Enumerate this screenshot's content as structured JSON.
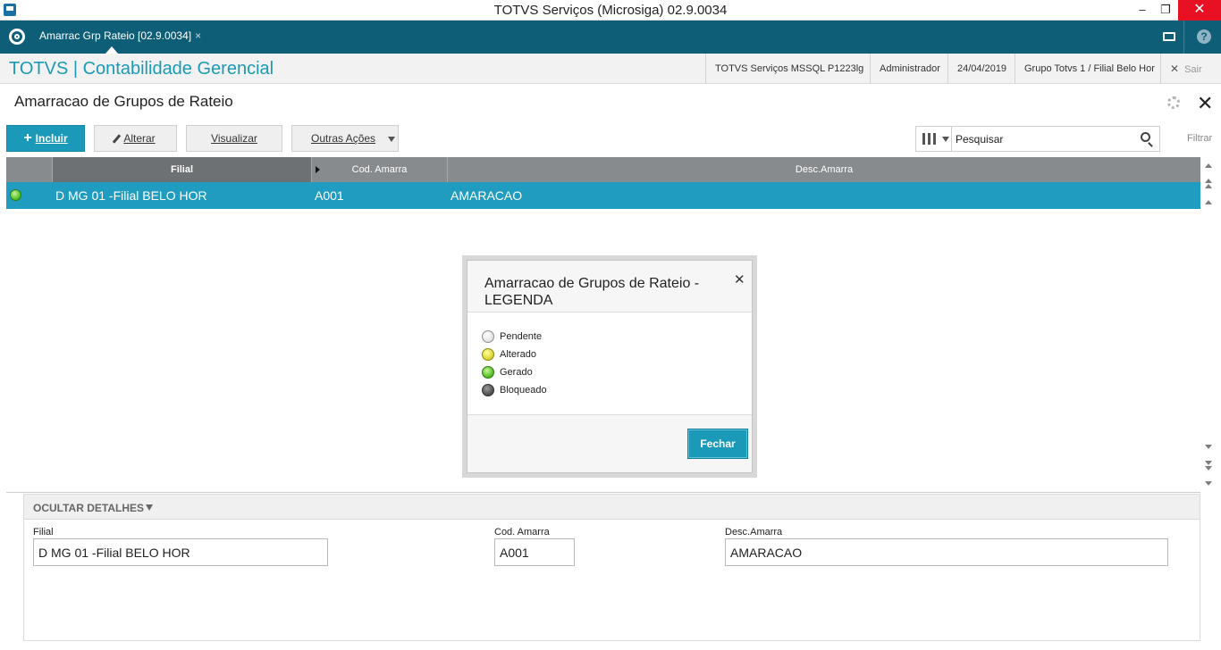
{
  "window": {
    "title": "TOTVS Serviços (Microsiga) 02.9.0034",
    "minimize": "–",
    "restore": "❐",
    "close": "✕"
  },
  "tabbar": {
    "tab_label": "Amarrac Grp Rateio [02.9.0034]",
    "tab_close": "×",
    "help": "?"
  },
  "module": {
    "title": "TOTVS | Contabilidade Gerencial",
    "server": "TOTVS Serviços MSSQL P1223lg",
    "user": "Administrador",
    "date": "24/04/2019",
    "branch": "Grupo Totvs 1 / Filial Belo Hor",
    "exit_icon": "✕",
    "exit_label": "Sair"
  },
  "page": {
    "title": "Amarracao de Grupos de Rateio",
    "close_icon": "✕"
  },
  "toolbar": {
    "incluir": "Incluir",
    "incluir_icon": "+",
    "alterar": "Alterar",
    "visualizar": "Visualizar",
    "outras_acoes": "Outras Ações",
    "search_placeholder": "Pesquisar",
    "filtrar": "Filtrar"
  },
  "grid": {
    "columns": [
      "Filial",
      "Cod. Amarra",
      "Desc.Amarra"
    ],
    "rows": [
      {
        "status": "Gerado",
        "filial": "D MG 01 -Filial BELO HOR",
        "cod": "A001",
        "desc": "AMARACAO"
      }
    ]
  },
  "modal": {
    "title": "Amarracao de Grupos de Rateio - LEGENDA",
    "close_icon": "✕",
    "legend": [
      {
        "label": "Pendente",
        "color": "#e0e0e0"
      },
      {
        "label": "Alterado",
        "color": "#d8d22a"
      },
      {
        "label": "Gerado",
        "color": "#49b81a"
      },
      {
        "label": "Bloqueado",
        "color": "#4b4b4b"
      }
    ],
    "button": "Fechar"
  },
  "details": {
    "toggle_label": "OCULTAR DETALHES",
    "fields": [
      {
        "label": "Filial",
        "value": "D MG 01 -Filial BELO HOR"
      },
      {
        "label": "Cod. Amarra",
        "value": "A001"
      },
      {
        "label": "Desc.Amarra",
        "value": "AMARACAO"
      }
    ]
  },
  "colors": {
    "accent": "#1a9ab8",
    "tabbar": "#0e5e78",
    "selected_row": "#1f9cc0",
    "grid_header": "#888b8d"
  }
}
